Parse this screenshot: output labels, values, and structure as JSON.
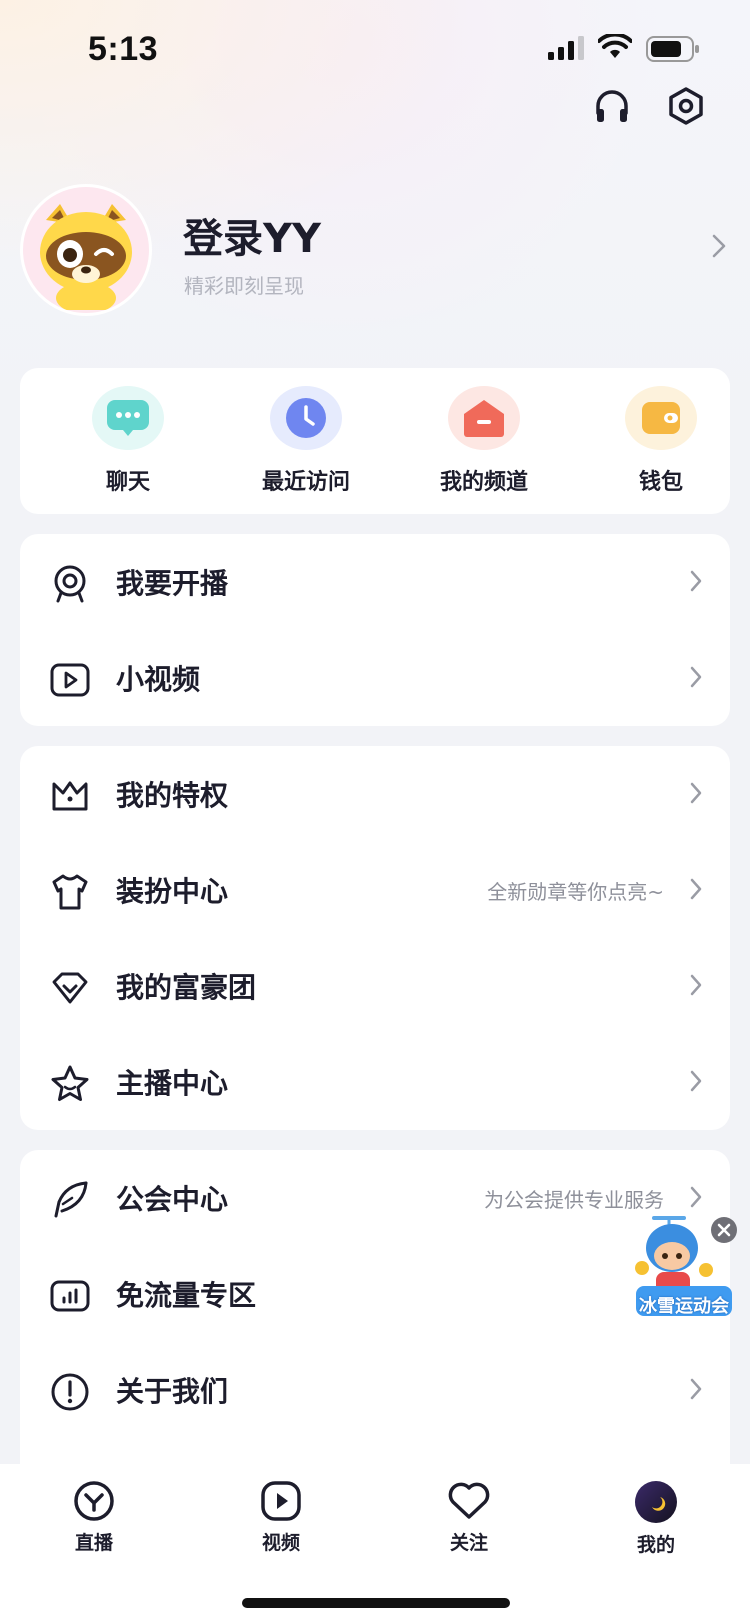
{
  "status": {
    "time": "5:13"
  },
  "profile": {
    "name": "登录YY",
    "subtitle": "精彩即刻呈现"
  },
  "quick_actions": [
    {
      "label": "聊天",
      "icon": "chat-icon",
      "color": "#5fd4cc"
    },
    {
      "label": "最近访问",
      "icon": "clock-icon",
      "color": "#6f86f0"
    },
    {
      "label": "我的频道",
      "icon": "home-icon",
      "color": "#f06a5a"
    },
    {
      "label": "钱包",
      "icon": "wallet-icon",
      "color": "#f6b843"
    }
  ],
  "menu_group_1": [
    {
      "label": "我要开播",
      "icon": "webcam-icon",
      "hint": ""
    },
    {
      "label": "小视频",
      "icon": "video-play-icon",
      "hint": ""
    }
  ],
  "menu_group_2": [
    {
      "label": "我的特权",
      "icon": "crown-icon",
      "hint": ""
    },
    {
      "label": "装扮中心",
      "icon": "tshirt-icon",
      "hint": "全新勋章等你点亮~"
    },
    {
      "label": "我的富豪团",
      "icon": "diamond-icon",
      "hint": ""
    },
    {
      "label": "主播中心",
      "icon": "star-icon",
      "hint": ""
    }
  ],
  "menu_group_3": [
    {
      "label": "公会中心",
      "icon": "feather-icon",
      "hint": "为公会提供专业服务"
    },
    {
      "label": "免流量专区",
      "icon": "data-bars-icon",
      "hint": ""
    },
    {
      "label": "关于我们",
      "icon": "info-icon",
      "hint": ""
    }
  ],
  "promo": {
    "label": "冰雪运动会"
  },
  "tabs": [
    {
      "label": "直播",
      "icon": "live-icon",
      "active": false
    },
    {
      "label": "视频",
      "icon": "video-icon",
      "active": false
    },
    {
      "label": "关注",
      "icon": "heart-icon",
      "active": false
    },
    {
      "label": "我的",
      "icon": "moon-avatar-icon",
      "active": true
    }
  ],
  "colors": {
    "accent": "#1d1d2c",
    "hint": "#8e909a",
    "background": "#f2f3f7"
  }
}
